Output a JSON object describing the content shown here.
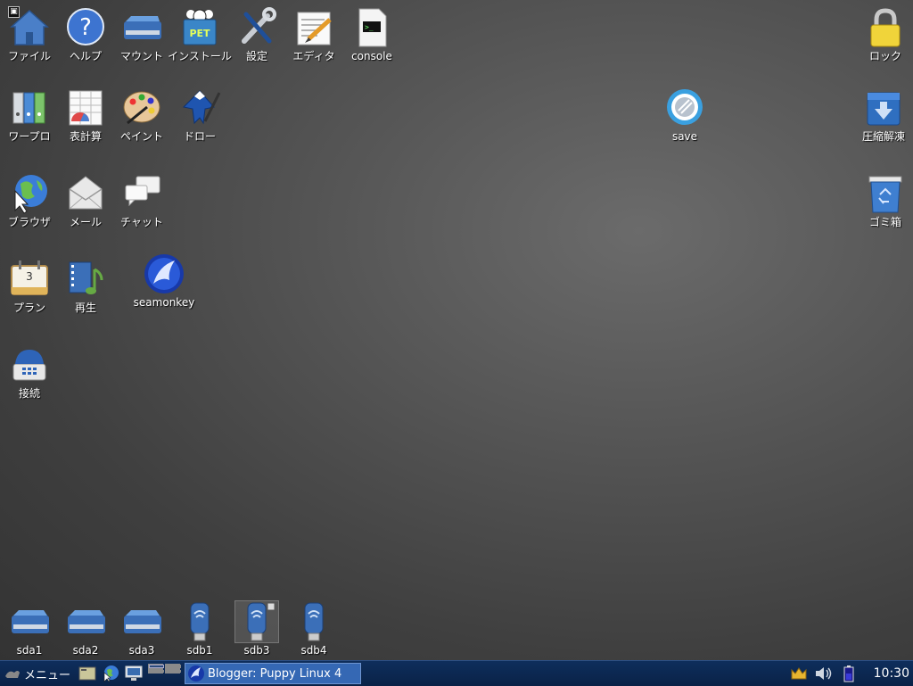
{
  "desktop": {
    "icons": [
      {
        "label": "ファイル",
        "icon": "home-icon"
      },
      {
        "label": "ヘルプ",
        "icon": "help-icon"
      },
      {
        "label": "マウント",
        "icon": "drive-icon"
      },
      {
        "label": "インストール",
        "icon": "pet-package-icon"
      },
      {
        "label": "設定",
        "icon": "tools-icon"
      },
      {
        "label": "エディタ",
        "icon": "editor-icon"
      },
      {
        "label": "console",
        "icon": "terminal-icon"
      },
      {
        "label": "ワープロ",
        "icon": "binders-icon"
      },
      {
        "label": "表計算",
        "icon": "spreadsheet-icon"
      },
      {
        "label": "ペイント",
        "icon": "palette-icon"
      },
      {
        "label": "ドロー",
        "icon": "draw-pen-icon"
      },
      {
        "label": "ブラウザ",
        "icon": "globe-icon"
      },
      {
        "label": "メール",
        "icon": "mail-icon"
      },
      {
        "label": "チャット",
        "icon": "chat-icon"
      },
      {
        "label": "プラン",
        "icon": "calendar-icon"
      },
      {
        "label": "再生",
        "icon": "media-icon"
      },
      {
        "label": "seamonkey",
        "icon": "seamonkey-icon"
      },
      {
        "label": "接続",
        "icon": "phone-icon"
      },
      {
        "label": "ロック",
        "icon": "padlock-icon"
      },
      {
        "label": "save",
        "icon": "save-icon"
      },
      {
        "label": "圧縮解凍",
        "icon": "archive-icon"
      },
      {
        "label": "ゴミ箱",
        "icon": "trash-icon"
      },
      {
        "label": "sda1",
        "icon": "hdd-icon"
      },
      {
        "label": "sda2",
        "icon": "hdd-icon"
      },
      {
        "label": "sda3",
        "icon": "hdd-icon"
      },
      {
        "label": "sdb1",
        "icon": "usb-drive-icon"
      },
      {
        "label": "sdb3",
        "icon": "usb-drive-icon"
      },
      {
        "label": "sdb4",
        "icon": "usb-drive-icon"
      }
    ],
    "calendar_day": "3"
  },
  "taskbar": {
    "menu_label": "メニュー",
    "task_title": "Blogger: Puppy Linux 4",
    "clock": "10:30"
  },
  "colors": {
    "taskbar_bg": "#0c2850",
    "task_button": "#3568b4",
    "desktop_bg": "#4a4a4a"
  }
}
